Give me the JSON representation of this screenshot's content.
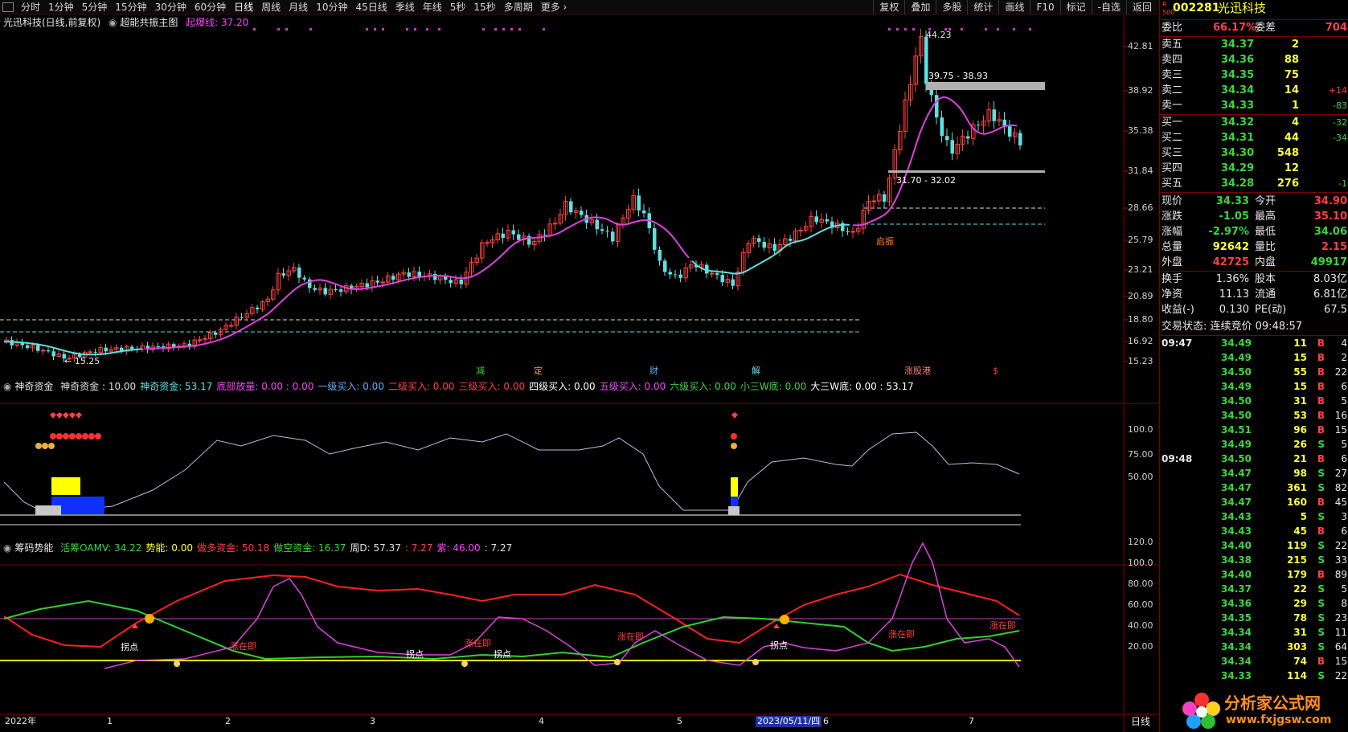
{
  "toolbar": {
    "periods": [
      "分时",
      "1分钟",
      "5分钟",
      "15分钟",
      "30分钟",
      "60分钟",
      "日线",
      "周线",
      "月线",
      "10分钟",
      "45日线",
      "季线",
      "年线",
      "5秒",
      "15秒",
      "多周期",
      "更多 ›"
    ],
    "selected": "日线",
    "right": [
      "复权",
      "叠加",
      "多股",
      "统计",
      "画线",
      "F10",
      "标记",
      "-自选",
      "返回"
    ]
  },
  "main_chart": {
    "stock_label": "光迅科技(日线,前复权)",
    "indicator_name": "超能共振主图",
    "indicator_value": "起爆线: 37.20",
    "high_label": "44.23",
    "low_label": "15.25",
    "zone_upper": "39.75 - 38.93",
    "zone_lower": "31.70 - 32.02",
    "y_ticks": [
      "42.81",
      "38.92",
      "35.38",
      "31.84",
      "28.66",
      "25.79",
      "23.21",
      "20.89",
      "18.80",
      "16.92",
      "15.23"
    ],
    "markers": [
      {
        "text": "减",
        "color": "#3cd63c"
      },
      {
        "text": "定",
        "color": "#ffa040"
      },
      {
        "text": "财",
        "color": "#5fb0ff"
      },
      {
        "text": "解",
        "color": "#5fe0e0"
      },
      {
        "text": "涨股港",
        "color": "#ff8080"
      },
      {
        "text": "$",
        "color": "#ff4040"
      }
    ],
    "start_label": "启振"
  },
  "indicator1": {
    "name": "神奇资金",
    "parts": [
      {
        "t": "神奇资金 : 10.00",
        "c": "#e0e0e0"
      },
      {
        "t": "神奇资金: 53.17",
        "c": "#5fe0e0"
      },
      {
        "t": "底部放量: 0.00 : 0.00",
        "c": "#ff40ff"
      },
      {
        "t": "一级买入: 0.00",
        "c": "#5fb0ff"
      },
      {
        "t": "二级买入: 0.00",
        "c": "#ff4040"
      },
      {
        "t": "三级买入: 0.00",
        "c": "#ff4040"
      },
      {
        "t": "四级买入: 0.00",
        "c": "#ffffff"
      },
      {
        "t": "五级买入: 0.00",
        "c": "#ff40ff"
      },
      {
        "t": "六级买入: 0.00",
        "c": "#3cd63c"
      },
      {
        "t": "小三W底: 0.00",
        "c": "#3cd63c"
      },
      {
        "t": "大三W底: 0.00 : 53.17",
        "c": "#ffffff"
      }
    ],
    "y_ticks": [
      "100.0",
      "75.00",
      "50.00"
    ]
  },
  "indicator2": {
    "name": "筹码势能",
    "parts": [
      {
        "t": "活筹OAMV: 34.22",
        "c": "#3cd63c"
      },
      {
        "t": "势能: 0.00",
        "c": "#ffff40"
      },
      {
        "t": "做多资金: 50.18",
        "c": "#ff4040"
      },
      {
        "t": "做空资金: 16.37",
        "c": "#3cd63c"
      },
      {
        "t": "周D: 57.37",
        "c": "#e0e0e0"
      },
      {
        "t": ": 7.27",
        "c": "#ff4040"
      },
      {
        "t": "紫: 46.00",
        "c": "#ff40ff"
      },
      {
        "t": ": 7.27",
        "c": "#e0e0e0"
      }
    ],
    "y_ticks": [
      "120.0",
      "100.0",
      "80.00",
      "60.00",
      "40.00",
      "20.00"
    ],
    "labels": [
      {
        "t": "拐点",
        "c": "#ffffff"
      },
      {
        "t": "涨在即",
        "c": "#ff4040"
      },
      {
        "t": "拐点",
        "c": "#ffffff"
      },
      {
        "t": "涨在即",
        "c": "#ff4040"
      },
      {
        "t": "拐点",
        "c": "#ffffff"
      },
      {
        "t": "涨在即",
        "c": "#ff4040"
      },
      {
        "t": "拐点",
        "c": "#ffffff"
      },
      {
        "t": "涨在即",
        "c": "#ff4040"
      },
      {
        "t": "涨在即",
        "c": "#ff4040"
      }
    ]
  },
  "x_axis": {
    "labels": [
      "2022年",
      "1",
      "2",
      "3",
      "4",
      "5",
      "6",
      "7"
    ],
    "cursor_date": "2023/05/11/四",
    "period": "日线"
  },
  "quote": {
    "code": "002281",
    "name": "光迅科技",
    "weibi": {
      "label": "委比",
      "value": "66.17%",
      "label2": "委差",
      "value2": "704"
    },
    "asks": [
      {
        "label": "卖五",
        "price": "34.37",
        "vol": "2",
        "chg": ""
      },
      {
        "label": "卖四",
        "price": "34.36",
        "vol": "88",
        "chg": ""
      },
      {
        "label": "卖三",
        "price": "34.35",
        "vol": "75",
        "chg": ""
      },
      {
        "label": "卖二",
        "price": "34.34",
        "vol": "14",
        "chg": "+14"
      },
      {
        "label": "卖一",
        "price": "34.33",
        "vol": "1",
        "chg": "-83"
      }
    ],
    "bids": [
      {
        "label": "买一",
        "price": "34.32",
        "vol": "4",
        "chg": "-32"
      },
      {
        "label": "买二",
        "price": "34.31",
        "vol": "44",
        "chg": "-34"
      },
      {
        "label": "买三",
        "price": "34.30",
        "vol": "548",
        "chg": ""
      },
      {
        "label": "买四",
        "price": "34.29",
        "vol": "12",
        "chg": ""
      },
      {
        "label": "买五",
        "price": "34.28",
        "vol": "276",
        "chg": "-1"
      }
    ],
    "stats": [
      {
        "l1": "现价",
        "v1": "34.33",
        "c1": "g",
        "l2": "今开",
        "v2": "34.90",
        "c2": "r"
      },
      {
        "l1": "涨跌",
        "v1": "-1.05",
        "c1": "g",
        "l2": "最高",
        "v2": "35.10",
        "c2": "r"
      },
      {
        "l1": "涨幅",
        "v1": "-2.97%",
        "c1": "g",
        "l2": "最低",
        "v2": "34.06",
        "c2": "g"
      },
      {
        "l1": "总量",
        "v1": "92642",
        "c1": "y",
        "l2": "量比",
        "v2": "2.15",
        "c2": "r"
      },
      {
        "l1": "外盘",
        "v1": "42725",
        "c1": "r",
        "l2": "内盘",
        "v2": "49917",
        "c2": "g"
      }
    ],
    "stats2": [
      {
        "l1": "换手",
        "v1": "1.36%",
        "l2": "股本",
        "v2": "8.03亿"
      },
      {
        "l1": "净资",
        "v1": "11.13",
        "l2": "流通",
        "v2": "6.81亿"
      },
      {
        "l1": "收益(-)",
        "v1": "0.130",
        "l2": "PE(动)",
        "v2": "67.5"
      }
    ],
    "trade_status": "交易状态: 连续竞价 09:48:57",
    "ticks": [
      {
        "time": "09:47",
        "price": "34.49",
        "vol": "11",
        "side": "B",
        "n": "4"
      },
      {
        "time": "",
        "price": "34.49",
        "vol": "15",
        "side": "B",
        "n": "2"
      },
      {
        "time": "",
        "price": "34.50",
        "vol": "55",
        "side": "B",
        "n": "22"
      },
      {
        "time": "",
        "price": "34.49",
        "vol": "15",
        "side": "B",
        "n": "6"
      },
      {
        "time": "",
        "price": "34.50",
        "vol": "31",
        "side": "B",
        "n": "5"
      },
      {
        "time": "",
        "price": "34.50",
        "vol": "53",
        "side": "B",
        "n": "16"
      },
      {
        "time": "",
        "price": "34.51",
        "vol": "96",
        "side": "B",
        "n": "15"
      },
      {
        "time": "",
        "price": "34.49",
        "vol": "26",
        "side": "S",
        "n": "5"
      },
      {
        "time": "09:48",
        "price": "34.50",
        "vol": "21",
        "side": "B",
        "n": "6"
      },
      {
        "time": "",
        "price": "34.47",
        "vol": "98",
        "side": "S",
        "n": "27"
      },
      {
        "time": "",
        "price": "34.47",
        "vol": "361",
        "side": "S",
        "n": "82"
      },
      {
        "time": "",
        "price": "34.47",
        "vol": "160",
        "side": "B",
        "n": "45"
      },
      {
        "time": "",
        "price": "34.43",
        "vol": "5",
        "side": "S",
        "n": "3"
      },
      {
        "time": "",
        "price": "34.43",
        "vol": "45",
        "side": "B",
        "n": "6"
      },
      {
        "time": "",
        "price": "34.40",
        "vol": "119",
        "side": "S",
        "n": "22"
      },
      {
        "time": "",
        "price": "34.38",
        "vol": "215",
        "side": "S",
        "n": "33"
      },
      {
        "time": "",
        "price": "34.40",
        "vol": "179",
        "side": "B",
        "n": "89"
      },
      {
        "time": "",
        "price": "34.37",
        "vol": "22",
        "side": "S",
        "n": "5"
      },
      {
        "time": "",
        "price": "34.36",
        "vol": "29",
        "side": "S",
        "n": "8"
      },
      {
        "time": "",
        "price": "34.35",
        "vol": "78",
        "side": "S",
        "n": "23"
      },
      {
        "time": "",
        "price": "34.34",
        "vol": "31",
        "side": "S",
        "n": "11"
      },
      {
        "time": "",
        "price": "34.34",
        "vol": "303",
        "side": "S",
        "n": "64"
      },
      {
        "time": "",
        "price": "34.34",
        "vol": "74",
        "side": "B",
        "n": "15"
      },
      {
        "time": "",
        "price": "34.33",
        "vol": "114",
        "side": "S",
        "n": "22"
      }
    ]
  },
  "watermark": {
    "name": "分析家公式网",
    "url": "www.fxjgsw.com"
  },
  "colors": {
    "up": "#ff4040",
    "down": "#5fe0e0",
    "ma": "#e040e0",
    "bg": "#000000",
    "grid": "#7a0000"
  }
}
